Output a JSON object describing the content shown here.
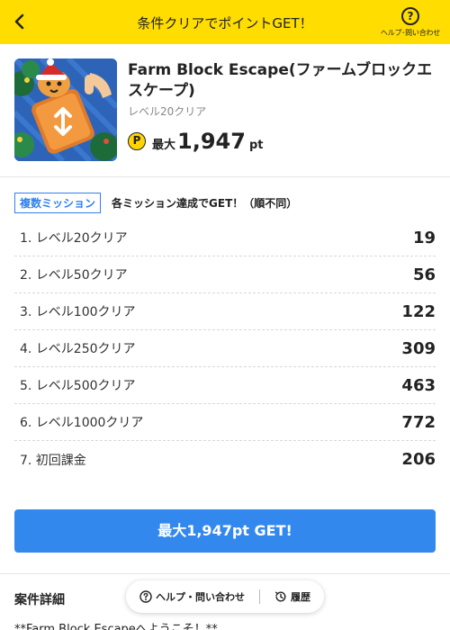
{
  "header": {
    "title": "条件クリアでポイントGET！",
    "help_label": "ヘルプ･問い合わせ",
    "help_glyph": "?",
    "back_icon": "chevron-left-icon"
  },
  "app": {
    "name": "Farm Block Escape(ファームブロックエスケープ)",
    "subtitle": "レベル20クリア",
    "reward_icon": "P",
    "reward_prefix": "最大",
    "reward_value": "1,947",
    "reward_unit": "pt"
  },
  "missions": {
    "tag": "複数ミッション",
    "description": "各ミッション達成でGET！（順不同）",
    "items": [
      {
        "label": "1. レベル20クリア",
        "points": "19"
      },
      {
        "label": "2. レベル50クリア",
        "points": "56"
      },
      {
        "label": "3. レベル100クリア",
        "points": "122"
      },
      {
        "label": "4. レベル250クリア",
        "points": "309"
      },
      {
        "label": "5. レベル500クリア",
        "points": "463"
      },
      {
        "label": "6. レベル1000クリア",
        "points": "772"
      },
      {
        "label": "7. 初回課金",
        "points": "206"
      }
    ]
  },
  "cta": {
    "label": "最大1,947pt GET!"
  },
  "details": {
    "title": "案件詳細",
    "body": "**Farm Block Escapeへようこそ！**"
  },
  "floating": {
    "help": "ヘルプ・問い合わせ",
    "history": "履歴"
  },
  "colors": {
    "header_bg": "#FFDD00",
    "accent_blue": "#3388EE",
    "coin_yellow": "#FFD400"
  }
}
